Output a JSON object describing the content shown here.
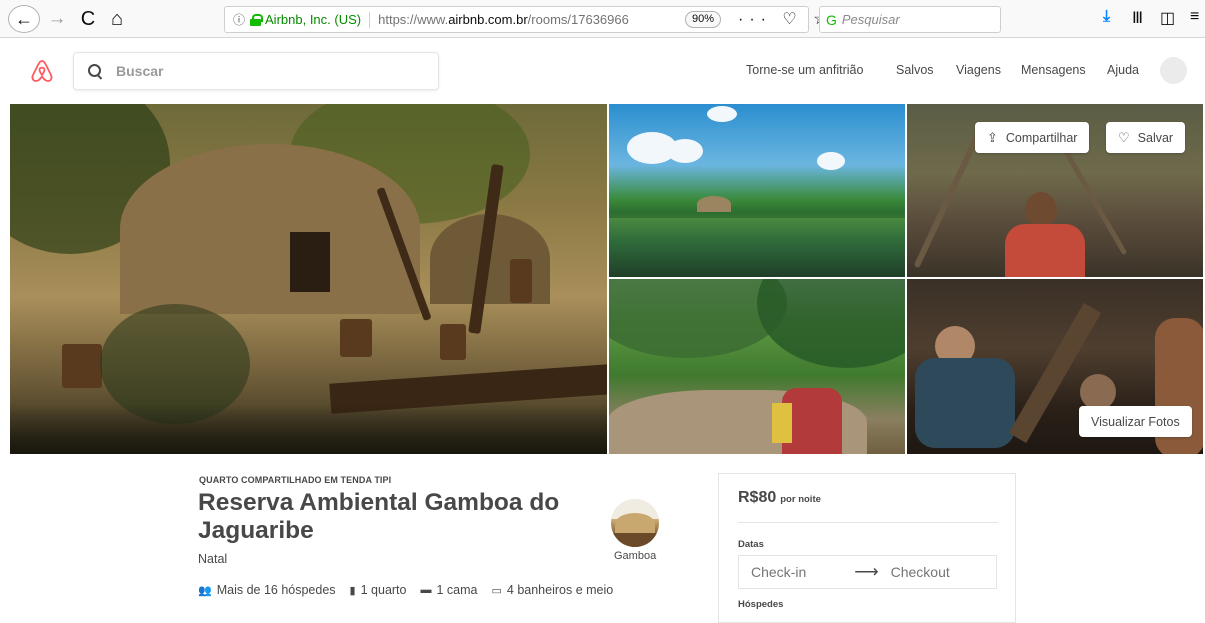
{
  "browser": {
    "back_icon": "←",
    "forward_icon": "→",
    "reload_icon": "C",
    "home_icon": "⌂",
    "info_icon": "ⓘ",
    "site_identity": "Airbnb, Inc. (US)",
    "url_prefix": "https://www.",
    "url_domain": "airbnb.com.br",
    "url_path": "/rooms/17636966",
    "zoom": "90%",
    "page_actions": "··· ♡ ☆",
    "search_placeholder": "Pesquisar",
    "search_icon": "G",
    "download_icon": "⤓",
    "library_icon": "Ⅲ",
    "sidebar_icon": "◫",
    "menu_icon": "≡"
  },
  "header": {
    "search_placeholder": "Buscar",
    "nav": [
      {
        "label": "Torne-se um anfitrião"
      },
      {
        "label": "Salvos"
      },
      {
        "label": "Viagens"
      },
      {
        "label": "Mensagens"
      },
      {
        "label": "Ajuda"
      }
    ],
    "brand_color": "#FF5A5F"
  },
  "photos": {
    "share_label": "Compartilhar",
    "save_label": "Salvar",
    "view_photos_label": "Visualizar Fotos",
    "share_icon": "⇪",
    "save_icon": "♡"
  },
  "listing": {
    "type": "QUARTO COMPARTILHADO EM TENDA TIPI",
    "title": "Reserva Ambiental Gamboa do Jaguaribe",
    "city": "Natal",
    "host_name": "Gamboa",
    "amenities": [
      {
        "icon": "guests-icon",
        "glyph": "👥",
        "label": "Mais de 16 hóspedes"
      },
      {
        "icon": "door-icon",
        "glyph": "▮",
        "label": "1 quarto"
      },
      {
        "icon": "bed-icon",
        "glyph": "▬",
        "label": "1 cama"
      },
      {
        "icon": "bath-icon",
        "glyph": "▭",
        "label": "4 banheiros e meio"
      }
    ]
  },
  "booking": {
    "price": "R$80",
    "per_night": "por noite",
    "dates_label": "Datas",
    "checkin_placeholder": "Check-in",
    "arrow": "⟶",
    "checkout_placeholder": "Checkout",
    "guests_label": "Hóspedes"
  }
}
